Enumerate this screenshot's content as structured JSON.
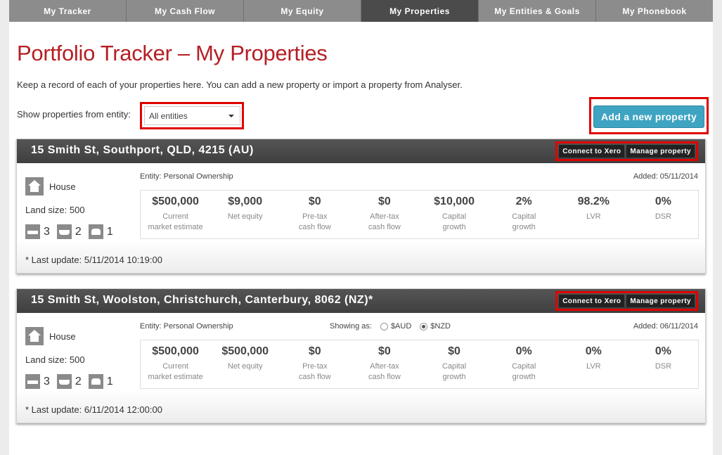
{
  "nav": {
    "tabs": [
      {
        "label": "My Tracker"
      },
      {
        "label": "My Cash Flow"
      },
      {
        "label": "My Equity"
      },
      {
        "label": "My Properties"
      },
      {
        "label": "My Entities & Goals"
      },
      {
        "label": "My Phonebook"
      }
    ],
    "active_tab": "My Properties"
  },
  "page": {
    "title": "Portfolio Tracker – My Properties",
    "intro": "Keep a record of each of your properties here. You can add a new property or import a property from Analyser.",
    "filter_label": "Show properties from entity:",
    "filter_value": "All entities",
    "add_button": "Add a new property"
  },
  "colors": {
    "title": "#b51f24",
    "accent": "#3ea4c1",
    "highlight": "#e00000"
  },
  "properties": [
    {
      "address": "15 Smith St, Southport, QLD, 4215 (AU)",
      "connect_label": "Connect to Xero",
      "manage_label": "Manage property",
      "type": "House",
      "land_size": "Land size: 500",
      "bedrooms": "3",
      "bathrooms": "2",
      "car_spaces": "1",
      "entity": "Entity: Personal Ownership",
      "added": "Added: 05/11/2014",
      "last_update": "* Last update: 5/11/2014 10:19:00",
      "metrics": [
        {
          "value": "$500,000",
          "label": "Current\nmarket estimate"
        },
        {
          "value": "$9,000",
          "label": "Net equity"
        },
        {
          "value": "$0",
          "label": "Pre-tax\ncash flow"
        },
        {
          "value": "$0",
          "label": "After-tax\ncash flow"
        },
        {
          "value": "$10,000",
          "label": "Capital\ngrowth"
        },
        {
          "value": "2%",
          "label": "Capital\ngrowth"
        },
        {
          "value": "98.2%",
          "label": "LVR"
        },
        {
          "value": "0%",
          "label": "DSR"
        }
      ]
    },
    {
      "address": "15 Smith St, Woolston, Christchurch, Canterbury, 8062 (NZ)*",
      "connect_label": "Connect to Xero",
      "manage_label": "Manage property",
      "type": "House",
      "land_size": "Land size: 500",
      "bedrooms": "3",
      "bathrooms": "2",
      "car_spaces": "1",
      "entity": "Entity: Personal Ownership",
      "showing_as": "Showing as:",
      "currency_aud": "$AUD",
      "currency_nzd": "$NZD",
      "currency_selected": "$NZD",
      "added": "Added: 06/11/2014",
      "last_update": "* Last update: 6/11/2014 12:00:00",
      "metrics": [
        {
          "value": "$500,000",
          "label": "Current\nmarket estimate"
        },
        {
          "value": "$500,000",
          "label": "Net equity"
        },
        {
          "value": "$0",
          "label": "Pre-tax\ncash flow"
        },
        {
          "value": "$0",
          "label": "After-tax\ncash flow"
        },
        {
          "value": "$0",
          "label": "Capital\ngrowth"
        },
        {
          "value": "0%",
          "label": "Capital\ngrowth"
        },
        {
          "value": "0%",
          "label": "LVR"
        },
        {
          "value": "0%",
          "label": "DSR"
        }
      ]
    }
  ]
}
